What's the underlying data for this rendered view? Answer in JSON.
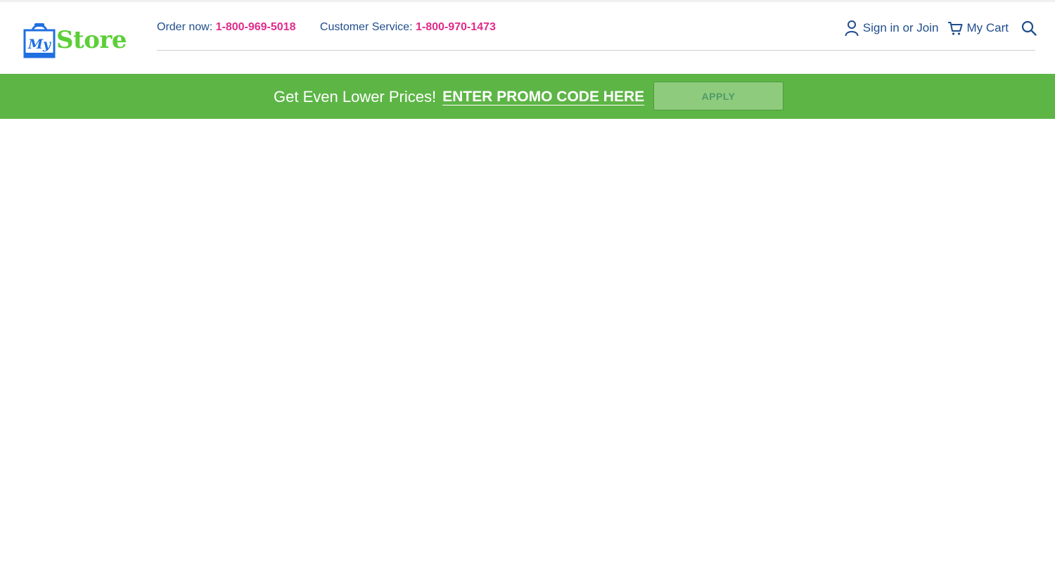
{
  "brand": {
    "logo_text": "Store",
    "logo_badge_text": "My",
    "logo_bag_icon": "shopping-bag-icon",
    "colors": {
      "blue": "#1f6fe0",
      "green": "#5ccf37"
    }
  },
  "header": {
    "order_label": "Order now:",
    "order_phone": "1-800-969-5018",
    "service_label": "Customer Service:",
    "service_phone": "1-800-970-1473",
    "sign_in_label": "Sign in or Join",
    "sign_in_icon": "user-icon",
    "cart_label": "My Cart",
    "cart_icon": "cart-icon",
    "search_icon": "search-icon"
  },
  "promo": {
    "headline": "Get Even Lower Prices!",
    "link_text": "ENTER PROMO CODE HERE",
    "apply_label": "APPLY",
    "bar_color": "#5db546"
  },
  "colors": {
    "text_blue": "#1f4e8c",
    "phone_pink": "#e02a8a"
  }
}
